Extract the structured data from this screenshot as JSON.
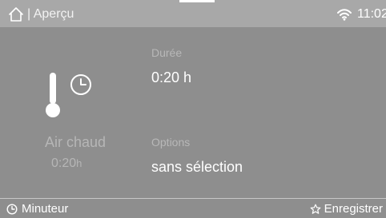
{
  "header": {
    "title": "| Aperçu",
    "time": "11:02",
    "home_icon": "home-icon",
    "wifi_icon": "wifi-icon"
  },
  "program": {
    "name": "Air chaud",
    "time": "0:20",
    "time_unit": "h",
    "icons": [
      "thermometer-icon",
      "clock-icon"
    ]
  },
  "settings": {
    "duration_label": "Durée",
    "duration_value": "0:20 h",
    "options_label": "Options",
    "options_value": "sans sélection"
  },
  "footer": {
    "timer_label": "Minuteur",
    "timer_icon": "clock-icon",
    "save_label": "Enregistrer",
    "save_icon": "star-icon"
  },
  "colors": {
    "background": "#8e8e8e",
    "header_background": "#a8a8a8",
    "primary_text": "#ffffff",
    "muted_text": "#b8b8b8"
  }
}
